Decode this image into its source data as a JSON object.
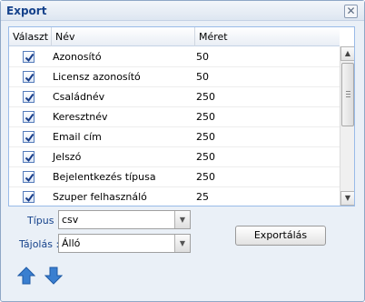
{
  "window": {
    "title": "Export",
    "close_icon": "close-icon"
  },
  "grid": {
    "columns": {
      "select": "Választ",
      "name": "Név",
      "size": "Méret"
    },
    "rows": [
      {
        "checked": true,
        "name": "Azonosító",
        "size": "50"
      },
      {
        "checked": true,
        "name": "Licensz azonosító",
        "size": "50"
      },
      {
        "checked": true,
        "name": "Családnév",
        "size": "250"
      },
      {
        "checked": true,
        "name": "Keresztnév",
        "size": "250"
      },
      {
        "checked": true,
        "name": "Email cím",
        "size": "250"
      },
      {
        "checked": true,
        "name": "Jelszó",
        "size": "250"
      },
      {
        "checked": true,
        "name": "Bejelentkezés típusa",
        "size": "250"
      },
      {
        "checked": true,
        "name": "Szuper felhasználó",
        "size": "25"
      }
    ]
  },
  "form": {
    "type_label": "Típus :",
    "type_value": "csv",
    "orientation_label": "Tájolás :",
    "orientation_value": "Álló",
    "export_label": "Exportálás"
  },
  "icons": {
    "up": "arrow-up-icon",
    "down": "arrow-down-icon"
  },
  "colors": {
    "accent": "#15428b",
    "arrow_blue": "#3a7fd0",
    "border": "#99bbe8"
  }
}
